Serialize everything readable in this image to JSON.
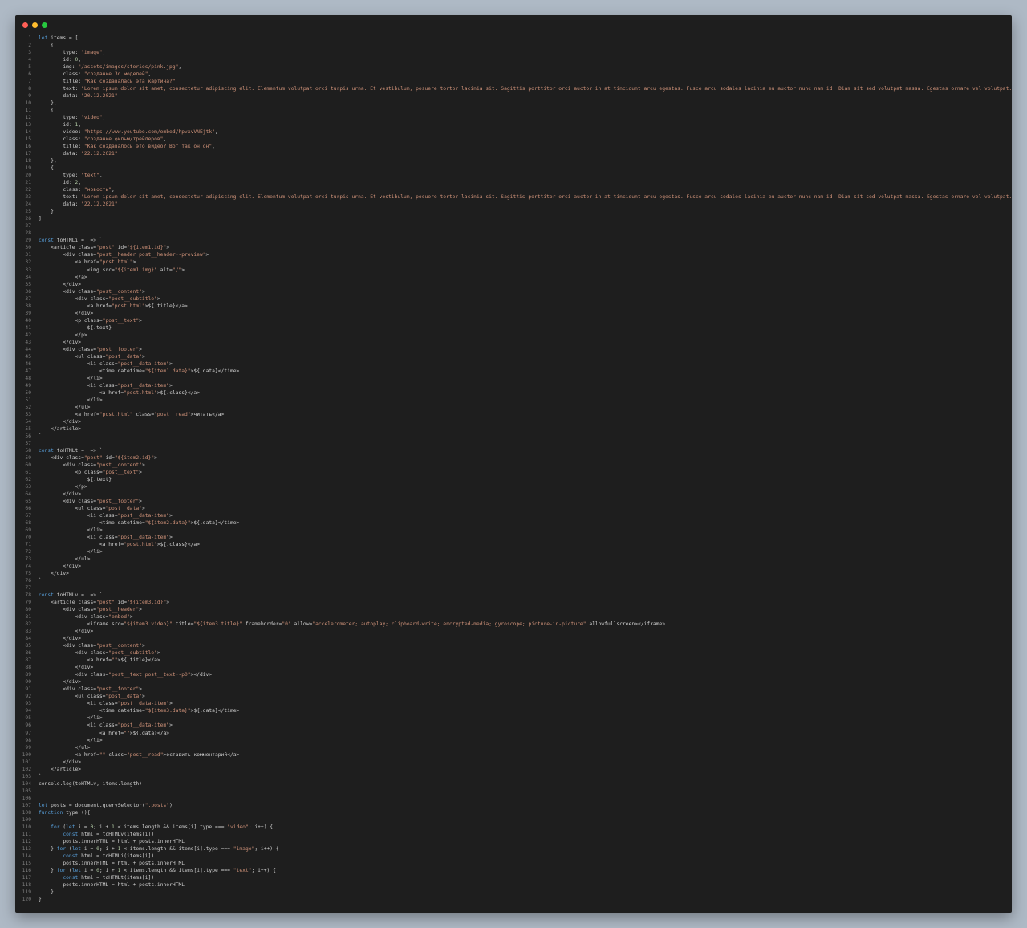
{
  "colors": {
    "page_background": "#aeb9c5",
    "editor_background": "#1e1e1e",
    "line_number": "#7f7f7f",
    "default_text": "#cfcfcf",
    "keyword": "#569cd6",
    "string": "#ce9178",
    "number": "#b5cea8",
    "traffic_close": "#ff5f56",
    "traffic_minimize": "#ffbd2e",
    "traffic_maximize": "#27c93f"
  },
  "window": {
    "buttons": [
      "close",
      "minimize",
      "maximize"
    ]
  },
  "code": {
    "lines": [
      "let items = [",
      "    {",
      "        type: \"image\",",
      "        id: 0,",
      "        img: \"/assets/images/stories/pink.jpg\",",
      "        class: \"создание 3d моделей\",",
      "        title: \"Как создавалась эта картина?\",",
      "        text: \"Lorem ipsum dolor sit amet, consectetur adipiscing elit. Elementum volutpat orci turpis urna. Et vestibulum, posuere tortor lacinia sit. Sagittis porttitor orci auctor in at tincidunt arcu egestas. Fusce arcu sodales lacinia eu auctor nunc nam id. Diam sit sed volutpat massa. Egestas ornare vel volutpat.\",",
      "        data: \"20.12.2021\"",
      "    },",
      "    {",
      "        type: \"video\",",
      "        id: 1,",
      "        video: \"https://www.youtube.com/embed/hpvxvVNEjtk\",",
      "        class: \"создание фильм/трейлеров\",",
      "        title: \"Как создавалось это видео? Вот так он он\",",
      "        data: \"22.12.2021\"",
      "    },",
      "    {",
      "        type: \"text\",",
      "        id: 2,",
      "        class: \"новость\",",
      "        text: \"Lorem ipsum dolor sit amet, consectetur adipiscing elit. Elementum volutpat orci turpis urna. Et vestibulum, posuere tortor lacinia sit. Sagittis porttitor orci auctor in at tincidunt arcu egestas. Fusce arcu sodales lacinia eu auctor nunc nam id. Diam sit sed volutpat massa. Egestas ornare vel volutpat.\",",
      "        data: \"22.12.2021\"",
      "    }",
      "]",
      "",
      "",
      "const toHTMLi = item1 => `",
      "    <article class=\"post\" id=\"${item1.id}\">",
      "        <div class=\"post__header post__header--preview\">",
      "            <a href=\"post.html\">",
      "                <img src=\"${item1.img}\" alt=\"/\">",
      "            </a>",
      "        </div>",
      "        <div class=\"post__content\">",
      "            <div class=\"post__subtitle\">",
      "                <a href=\"post.html\">${item1.title}</a>",
      "            </div>",
      "            <p class=\"post__text\">",
      "                ${item1.text}",
      "            </p>",
      "        </div>",
      "        <div class=\"post__footer\">",
      "            <ul class=\"post__data\">",
      "                <li class=\"post__data-item\">",
      "                    <time datetime=\"${item1.data}\">${item1.data}</time>",
      "                </li>",
      "                <li class=\"post__data-item\">",
      "                    <a href=\"post.html\">${item1.class}</a>",
      "                </li>",
      "            </ul>",
      "            <a href=\"post.html\" class=\"post__read\">читать</a>",
      "        </div>",
      "    </article>",
      "`",
      "",
      "const toHTMLt = item2 => `",
      "    <div class=\"post\" id=\"${item2.id}\">",
      "        <div class=\"post__content\">",
      "            <p class=\"post__text\">",
      "                ${item2.text}",
      "            </p>",
      "        </div>",
      "        <div class=\"post__footer\">",
      "            <ul class=\"post__data\">",
      "                <li class=\"post__data-item\">",
      "                    <time datetime=\"${item2.data}\">${item2.data}</time>",
      "                </li>",
      "                <li class=\"post__data-item\">",
      "                    <a href=\"post.html\">${item2.class}</a>",
      "                </li>",
      "            </ul>",
      "        </div>",
      "    </div>",
      "`",
      "",
      "const toHTMLv = item3 => `",
      "    <article class=\"post\" id=\"${item3.id}\">",
      "        <div class=\"post__header\">",
      "            <div class=\"embed\">",
      "                <iframe src=\"${item3.video}\" title=\"${item3.title}\" frameborder=\"0\" allow=\"accelerometer; autoplay; clipboard-write; encrypted-media; gyroscope; picture-in-picture\" allowfullscreen></iframe>",
      "            </div>",
      "        </div>",
      "        <div class=\"post__content\">",
      "            <div class=\"post__subtitle\">",
      "                <a href=\"\">${item3.title}</a>",
      "            </div>",
      "            <div class=\"post__text post__text--p0\"></div>",
      "        </div>",
      "        <div class=\"post__footer\">",
      "            <ul class=\"post__data\">",
      "                <li class=\"post__data-item\">",
      "                    <time datetime=\"${item3.data}\">${item3.data}</time>",
      "                </li>",
      "                <li class=\"post__data-item\">",
      "                    <a href=\"\">${item3.data}</a>",
      "                </li>",
      "            </ul>",
      "            <a href=\"\" class=\"post__read\">оставить комментарий</a>",
      "        </div>",
      "    </article>",
      "`",
      "console.log(toHTMLv, items.length)",
      "",
      "",
      "let posts = document.querySelector(\".posts\")",
      "function type (){",
      "",
      "    for (let i = 0; i + 1 < items.length && items[i].type === \"video\"; i++) {",
      "        const html = toHTMLv(items[i])",
      "        posts.innerHTML = html + posts.innerHTML",
      "    } for (let i = 0; i + 1 < items.length && items[i].type === \"image\"; i++) {",
      "        const html = toHTMLi(items[i])",
      "        posts.innerHTML = html + posts.innerHTML",
      "    } for (let i = 0; i + 1 < items.length && items[i].type === \"text\"; i++) {",
      "        const html = toHTMLt(items[i])",
      "        posts.innerHTML = html + posts.innerHTML",
      "    }",
      "}"
    ]
  }
}
